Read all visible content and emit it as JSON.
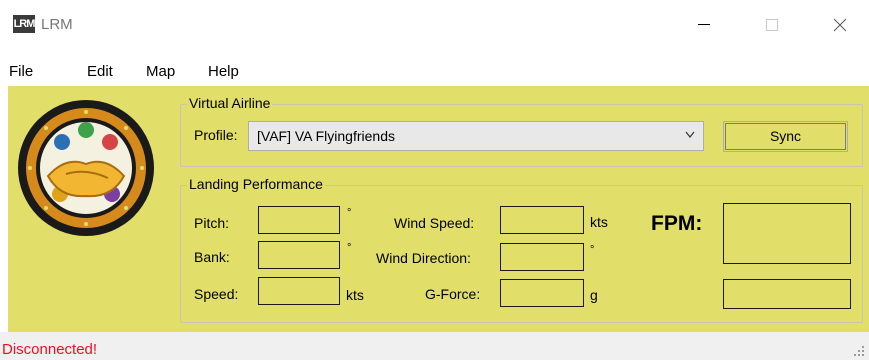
{
  "window": {
    "logo_text": "LRM",
    "title": "LRM"
  },
  "menu": [
    "File",
    "Edit",
    "Map",
    "Help"
  ],
  "virtual_airline": {
    "group_title": "Virtual Airline",
    "profile_label": "Profile:",
    "profile_value": "[VAF] VA Flyingfriends",
    "sync_label": "Sync"
  },
  "landing": {
    "group_title": "Landing Performance",
    "pitch_label": "Pitch:",
    "pitch_unit": "°",
    "bank_label": "Bank:",
    "bank_unit": "°",
    "speed_label": "Speed:",
    "speed_unit": "kts",
    "wind_speed_label": "Wind Speed:",
    "wind_speed_unit": "kts",
    "wind_direction_label": "Wind Direction:",
    "wind_direction_unit": "°",
    "gforce_label": "G-Force:",
    "gforce_unit": "g",
    "fpm_label": "FPM:",
    "pitch_value": "",
    "bank_value": "",
    "speed_value": "",
    "wind_speed_value": "",
    "wind_direction_value": "",
    "gforce_value": "",
    "fpm_value": "",
    "fpm_secondary_value": ""
  },
  "status": {
    "text": "Disconnected!",
    "color": "#e81123"
  },
  "colors": {
    "panel": "#e1df6a"
  }
}
